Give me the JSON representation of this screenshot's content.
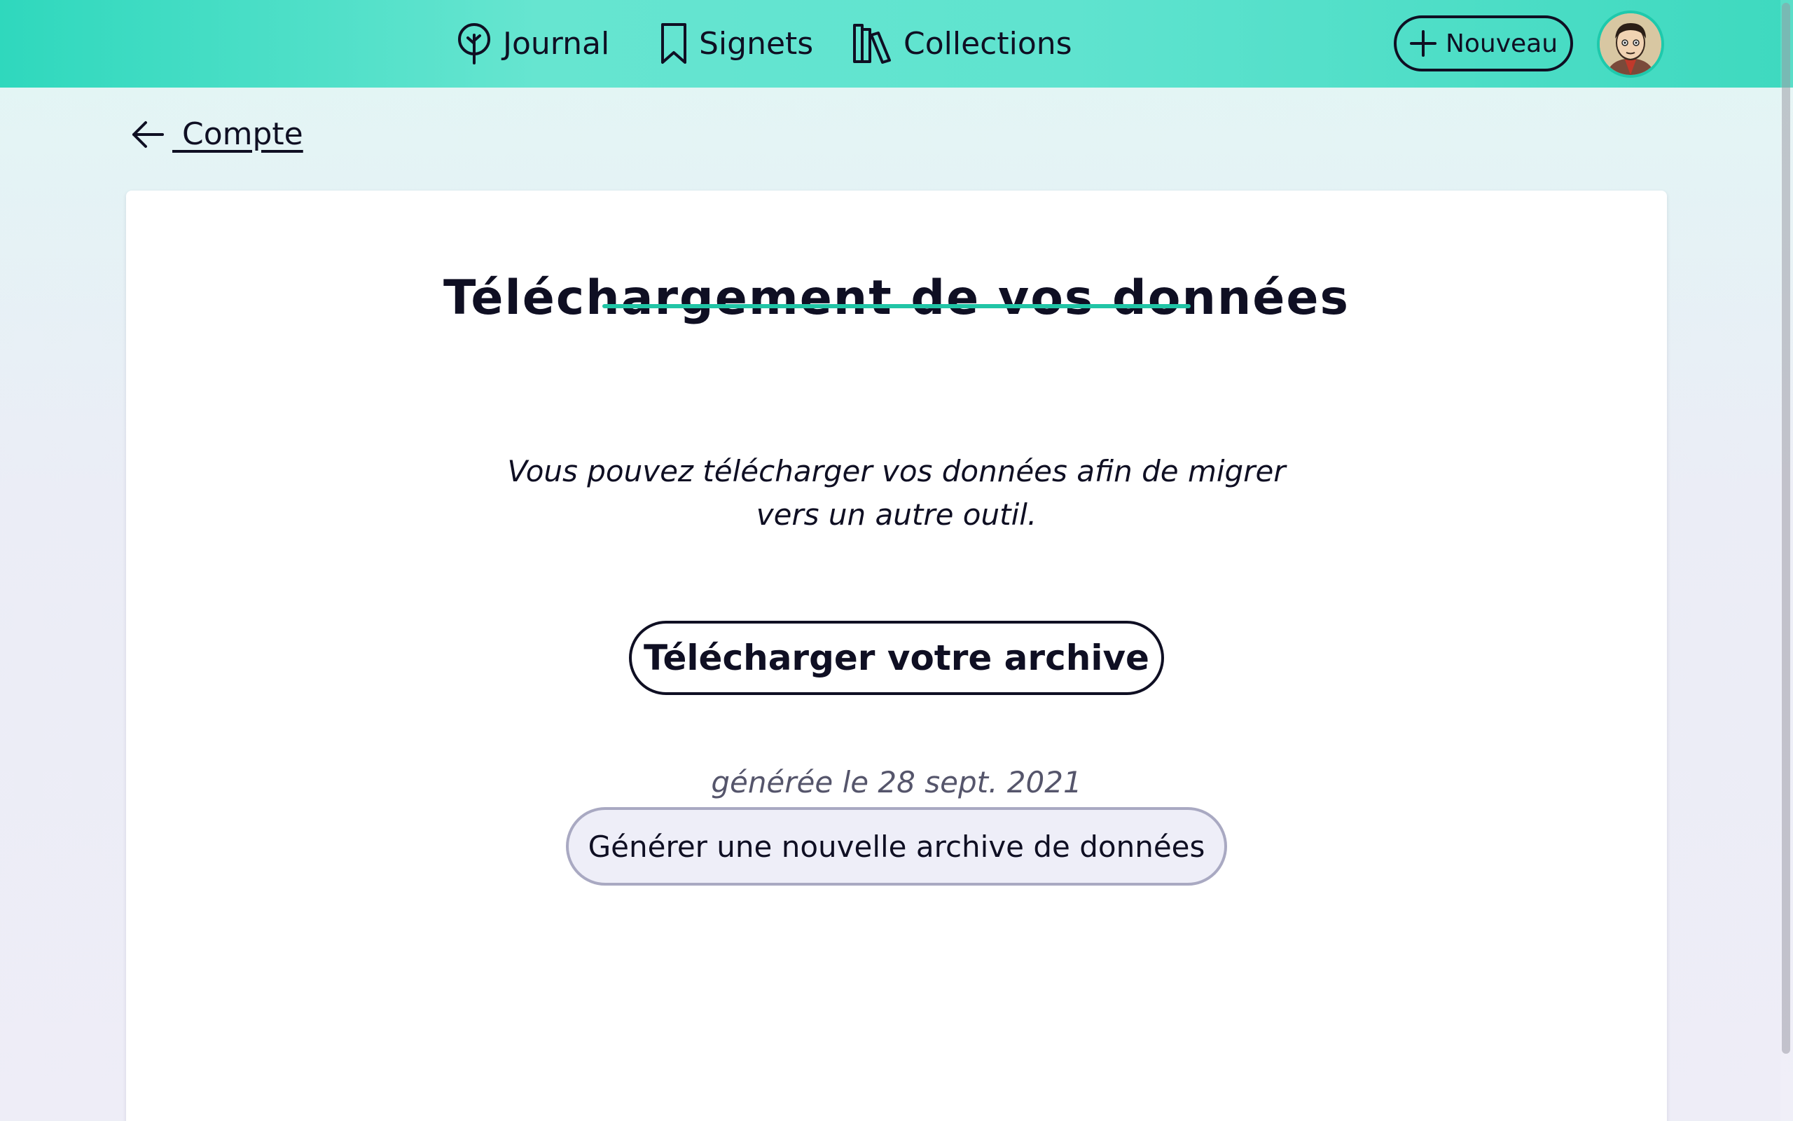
{
  "nav": {
    "items": [
      {
        "label": "Journal",
        "icon": "tree-icon"
      },
      {
        "label": "Signets",
        "icon": "bookmark-icon"
      },
      {
        "label": "Collections",
        "icon": "library-icon"
      }
    ],
    "new_button": {
      "label": "Nouveau",
      "icon": "plus-icon"
    },
    "avatar": {
      "icon": "user-avatar"
    }
  },
  "back_link": {
    "label": " Compte",
    "icon": "arrow-left-icon"
  },
  "card": {
    "title": "Téléchargement de vos données",
    "description": "Vous pouvez télécharger vos données afin de migrer vers un autre outil.",
    "download_button": "Télécharger votre archive",
    "generated_date": "générée le 28 sept. 2021",
    "generate_button": "Générer une nouvelle archive de données"
  },
  "colors": {
    "accent": "#21c5a6",
    "header": "#5fe3cf",
    "text": "#0f0f23",
    "muted": "#55556b"
  }
}
